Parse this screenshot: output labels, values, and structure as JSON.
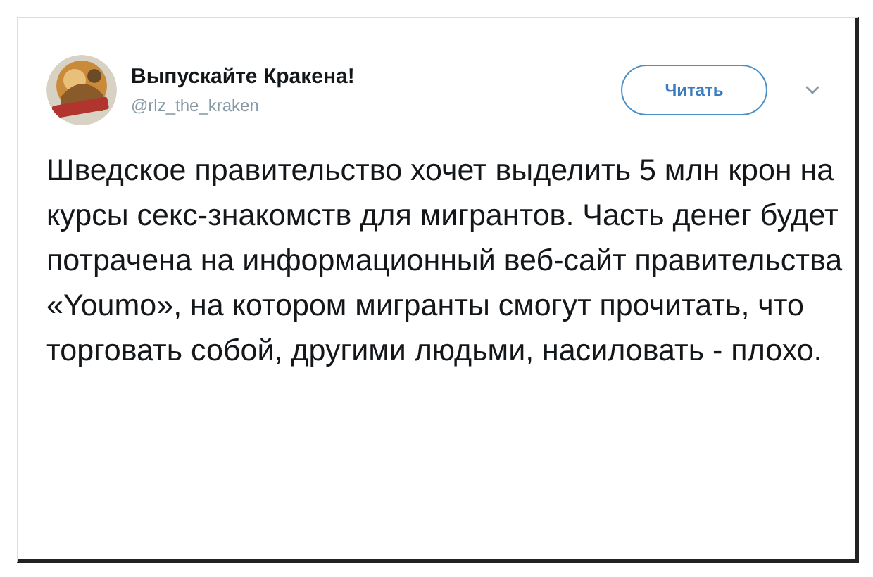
{
  "author": {
    "name": "Выпускайте Кракена!",
    "handle": "@rlz_the_kraken"
  },
  "follow_button": {
    "label": "Читать"
  },
  "tweet": {
    "text": "Шведское правительство хочет выделить 5 млн крон на курсы секс-знакомств для мигрантов. Часть денег будет потрачена на информационный веб-сайт правительства «Youmo», на котором мигранты смогут прочитать, что торговать собой, другими людьми, насиловать - плохо."
  }
}
